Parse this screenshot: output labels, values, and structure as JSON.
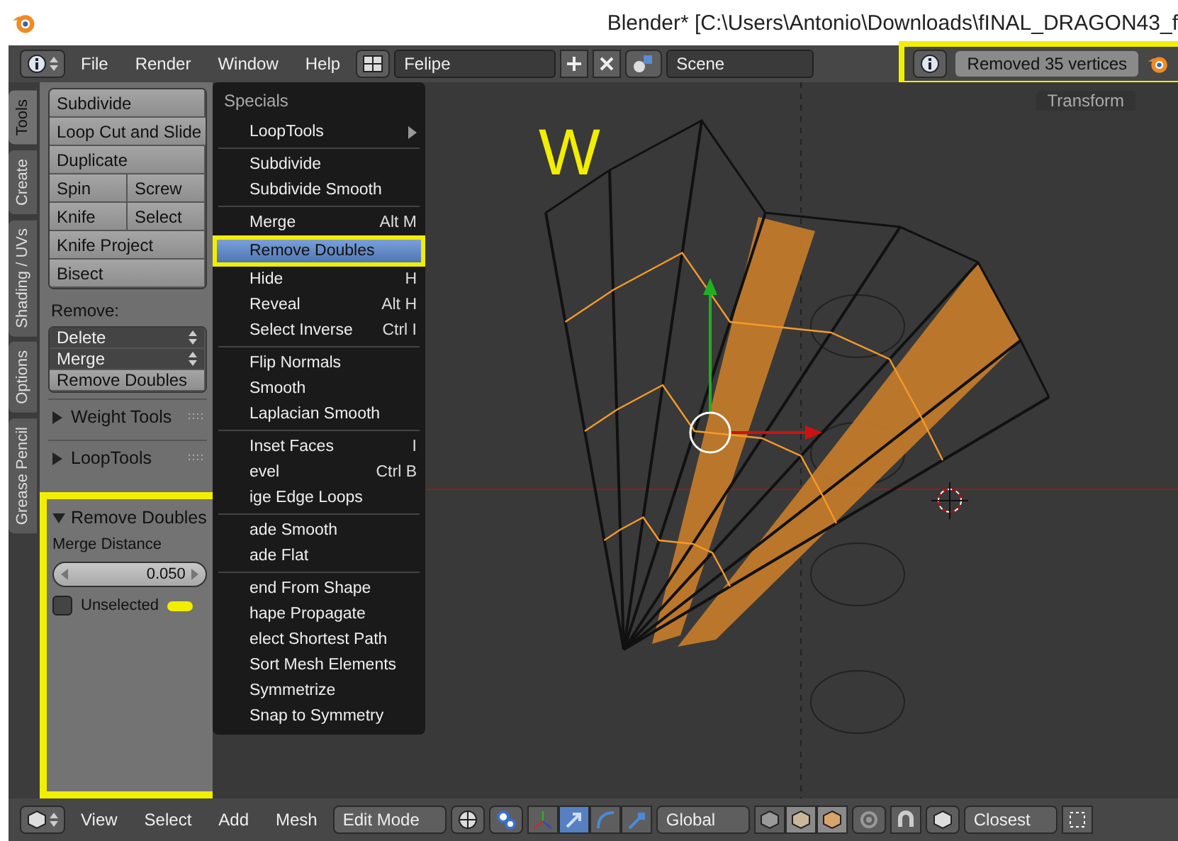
{
  "window": {
    "title": "Blender* [C:\\Users\\Antonio\\Downloads\\fINAL_DRAGON43_f"
  },
  "header": {
    "menus": [
      "File",
      "Render",
      "Window",
      "Help"
    ],
    "screen_layout": "Felipe",
    "scene": "Scene",
    "report": "Removed 35 vertices"
  },
  "tool_tabs": [
    {
      "label": "Tools",
      "selected": true
    },
    {
      "label": "Create",
      "selected": false
    },
    {
      "label": "Shading / UVs",
      "selected": false
    },
    {
      "label": "Options",
      "selected": false
    },
    {
      "label": "Grease Pencil",
      "selected": false
    }
  ],
  "tools_panel": {
    "button_rows": [
      [
        "Subdivide"
      ],
      [
        "Loop Cut and Slide"
      ],
      [
        "Duplicate"
      ],
      [
        "Spin",
        "Screw"
      ],
      [
        "Knife",
        "Select"
      ],
      [
        "Knife Project"
      ],
      [
        "Bisect"
      ]
    ],
    "remove_label": "Remove:",
    "remove_controls": [
      {
        "label": "Delete",
        "kind": "dropdown"
      },
      {
        "label": "Merge",
        "kind": "dropdown"
      },
      {
        "label": "Remove Doubles",
        "kind": "button"
      }
    ],
    "subpanels": [
      {
        "title": "Weight Tools",
        "expanded": false
      },
      {
        "title": "LoopTools",
        "expanded": false
      }
    ]
  },
  "operator_panel": {
    "title": "Remove Doubles",
    "expanded": true,
    "field_label": "Merge Distance",
    "merge_distance": "0.050",
    "options": [
      {
        "label": "Unselected",
        "checked": false
      }
    ]
  },
  "specials_menu": {
    "title": "Specials",
    "sections": [
      [
        {
          "label": "LoopTools",
          "submenu": true,
          "selected": false
        }
      ],
      [
        {
          "label": "Subdivide",
          "selected": false
        },
        {
          "label": "Subdivide Smooth",
          "selected": false
        }
      ],
      [
        {
          "label": "Merge",
          "shortcut": "Alt M",
          "selected": false
        },
        {
          "label": "Remove Doubles",
          "selected": true
        },
        {
          "label": "Hide",
          "shortcut": "H",
          "selected": false
        },
        {
          "label": "Reveal",
          "shortcut": "Alt H",
          "selected": false
        },
        {
          "label": "Select Inverse",
          "shortcut": "Ctrl I",
          "selected": false
        }
      ],
      [
        {
          "label": "Flip Normals",
          "selected": false
        },
        {
          "label": "Smooth",
          "selected": false
        },
        {
          "label": "Laplacian Smooth",
          "selected": false
        }
      ],
      [
        {
          "label": "Inset Faces",
          "shortcut": "I",
          "selected": false
        },
        {
          "label": "evel",
          "shortcut": "Ctrl B",
          "selected": false
        },
        {
          "label": "ige Edge Loops",
          "selected": false
        }
      ],
      [
        {
          "label": "ade Smooth",
          "selected": false
        },
        {
          "label": "ade Flat",
          "selected": false
        }
      ],
      [
        {
          "label": "end From Shape",
          "selected": false
        },
        {
          "label": "hape Propagate",
          "selected": false
        },
        {
          "label": "elect Shortest Path",
          "selected": false
        },
        {
          "label": "Sort Mesh Elements",
          "selected": false
        },
        {
          "label": "Symmetrize",
          "selected": false
        },
        {
          "label": "Snap to Symmetry",
          "selected": false
        }
      ]
    ]
  },
  "viewport": {
    "panel_tab": "Transform",
    "annotation": "W"
  },
  "bottom_bar": {
    "menus": [
      "View",
      "Select",
      "Add",
      "Mesh"
    ],
    "mode": "Edit Mode",
    "orientation": "Global",
    "snap_target": "Closest",
    "manipulators": [
      {
        "kind": "axes",
        "selected": false
      },
      {
        "kind": "translate",
        "selected": true
      },
      {
        "kind": "rotate",
        "selected": false
      },
      {
        "kind": "scale",
        "selected": false
      }
    ]
  }
}
